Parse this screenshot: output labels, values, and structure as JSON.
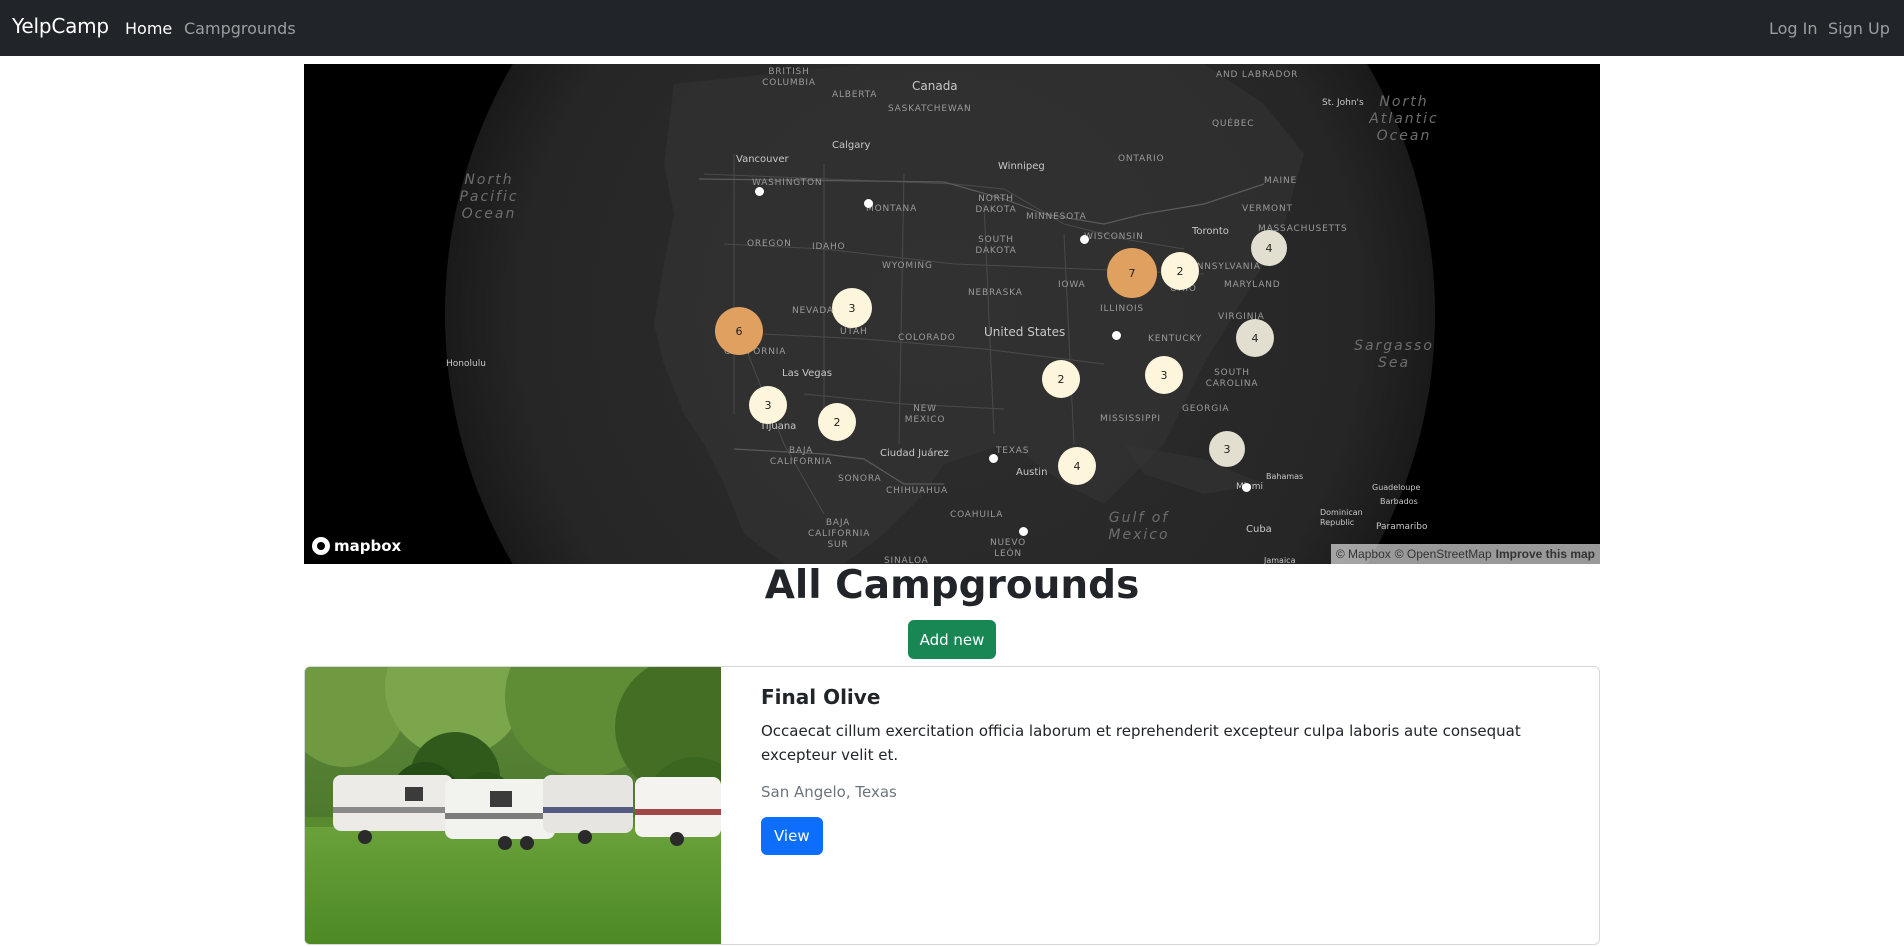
{
  "nav": {
    "brand": "YelpCamp",
    "home": "Home",
    "campgrounds": "Campgrounds",
    "login": "Log In",
    "signup": "Sign Up"
  },
  "map": {
    "labels": {
      "canada": "Canada",
      "united_states": "United States",
      "alberta": "ALBERTA",
      "saskatchewan": "SASKATCHEWAN",
      "british_columbia": "BRITISH COLUMBIA",
      "ontario": "ONTARIO",
      "quebec": "QUÉBEC",
      "labrador": "AND LABRADOR",
      "washington": "WASHINGTON",
      "montana": "MONTANA",
      "north_dakota": "NORTH DAKOTA",
      "south_dakota": "SOUTH DAKOTA",
      "minnesota": "MINNESOTA",
      "wisconsin": "WISCONSIN",
      "oregon": "OREGON",
      "idaho": "IDAHO",
      "wyoming": "WYOMING",
      "nebraska": "NEBRASKA",
      "iowa": "IOWA",
      "illinois": "ILLINOIS",
      "nevada": "NEVADA",
      "utah": "UTAH",
      "colorado": "COLORADO",
      "california": "CALIFORNIA",
      "kentucky": "KENTUCKY",
      "virginia": "VIRGINIA",
      "maryland": "MARYLAND",
      "pennsylvania": "PENNSYLVANIA",
      "ohio": "OHIO",
      "vermont": "VERMONT",
      "maine": "MAINE",
      "massachusetts": "MASSACHUSETTS",
      "south_carolina": "SOUTH CAROLINA",
      "georgia": "GEORGIA",
      "mississippi": "MISSISSIPPI",
      "new_mexico": "NEW MEXICO",
      "texas": "TEXAS",
      "baja_california": "BAJA CALIFORNIA",
      "baja_california_sur": "BAJA CALIFORNIA SUR",
      "sonora": "SONORA",
      "chihuahua": "CHIHUAHUA",
      "coahuila": "COAHUILA",
      "nuevo_leon": "NUEVO LEÓN",
      "sinaloa": "SINALOA",
      "vancouver": "Vancouver",
      "calgary": "Calgary",
      "winnipeg": "Winnipeg",
      "toronto": "Toronto",
      "st_johns": "St. John's",
      "las_vegas": "Las Vegas",
      "tijuana": "Tijuana",
      "ciudad_juarez": "Ciudad Juárez",
      "austin": "Austin",
      "miami": "Miami",
      "honolulu": "Honolulu",
      "bahamas": "Bahamas",
      "cuba": "Cuba",
      "jamaica": "Jamaica",
      "dominican_republic": "Dominican Republic",
      "guadeloupe": "Guadeloupe",
      "barbados": "Barbados",
      "paramaribo": "Paramaribo",
      "north_pacific_ocean": "North Pacific Ocean",
      "north_atlantic_ocean": "North Atlantic Ocean",
      "sargasso_sea": "Sargasso Sea",
      "gulf_of_mexico": "Gulf of Mexico"
    },
    "clusters": [
      {
        "count": "6",
        "color": "#e0a060"
      },
      {
        "count": "3",
        "color": "#fdf6dc"
      },
      {
        "count": "7",
        "color": "#e0a060"
      },
      {
        "count": "2",
        "color": "#fdf6dc"
      },
      {
        "count": "4",
        "color": "#e2dfd0"
      },
      {
        "count": "4",
        "color": "#e2dfd0"
      },
      {
        "count": "3",
        "color": "#fdf6dc"
      },
      {
        "count": "2",
        "color": "#fdf6dc"
      },
      {
        "count": "3",
        "color": "#fdf6dc"
      },
      {
        "count": "2",
        "color": "#fdf6dc"
      },
      {
        "count": "4",
        "color": "#fdf6dc"
      },
      {
        "count": "3",
        "color": "#e2dfd0"
      }
    ],
    "mapbox_logo": "mapbox",
    "attribution": {
      "mapbox": "© Mapbox",
      "osm": "© OpenStreetMap",
      "improve": "Improve this map"
    }
  },
  "page": {
    "title": "All Campgrounds",
    "add_new": "Add new"
  },
  "campgrounds": [
    {
      "title": "Final Olive",
      "description": "Occaecat cillum exercitation officia laborum et reprehenderit excepteur culpa laboris aute consequat excepteur velit et.",
      "location": "San Angelo, Texas",
      "view_label": "View"
    }
  ],
  "colors": {
    "navbar": "#212529",
    "success": "#198754",
    "primary": "#0d6efd",
    "cluster_large": "#e0a060",
    "cluster_small": "#fdf6dc"
  }
}
